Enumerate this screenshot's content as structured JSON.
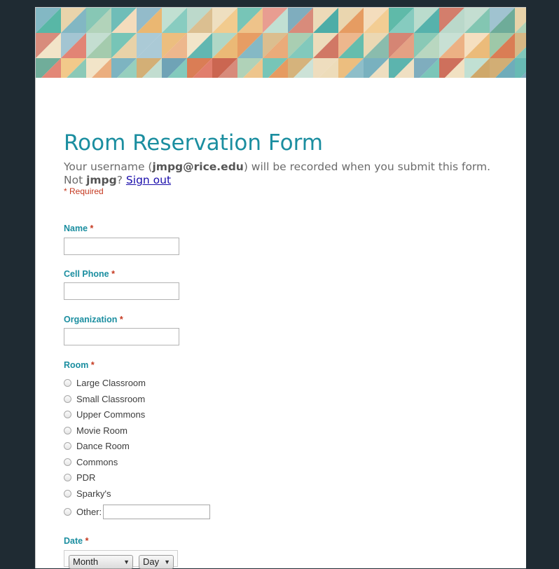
{
  "form": {
    "title": "Room Reservation Form",
    "description": {
      "prefix": "Your username (",
      "username": "jmpg@rice.edu",
      "middle": ") will be recorded when you submit this form. Not",
      "short_user": "jmpg",
      "suffix": "?",
      "sign_out": "Sign out"
    },
    "required_note": "* Required",
    "required_mark": "*",
    "fields": {
      "name": {
        "label": "Name",
        "value": ""
      },
      "cell_phone": {
        "label": "Cell Phone",
        "value": ""
      },
      "organization": {
        "label": "Organization",
        "value": ""
      }
    },
    "room": {
      "label": "Room",
      "options": [
        "Large Classroom",
        "Small Classroom",
        "Upper Commons",
        "Movie Room",
        "Dance Room",
        "Commons",
        "PDR",
        "Sparky's"
      ],
      "other_label": "Other:",
      "other_value": ""
    },
    "date": {
      "label": "Date",
      "month_value": "Month",
      "day_value": "Day"
    }
  },
  "colors": {
    "accent": "#1b8ea0",
    "required": "#c5381f",
    "background": "#1f2b33"
  }
}
